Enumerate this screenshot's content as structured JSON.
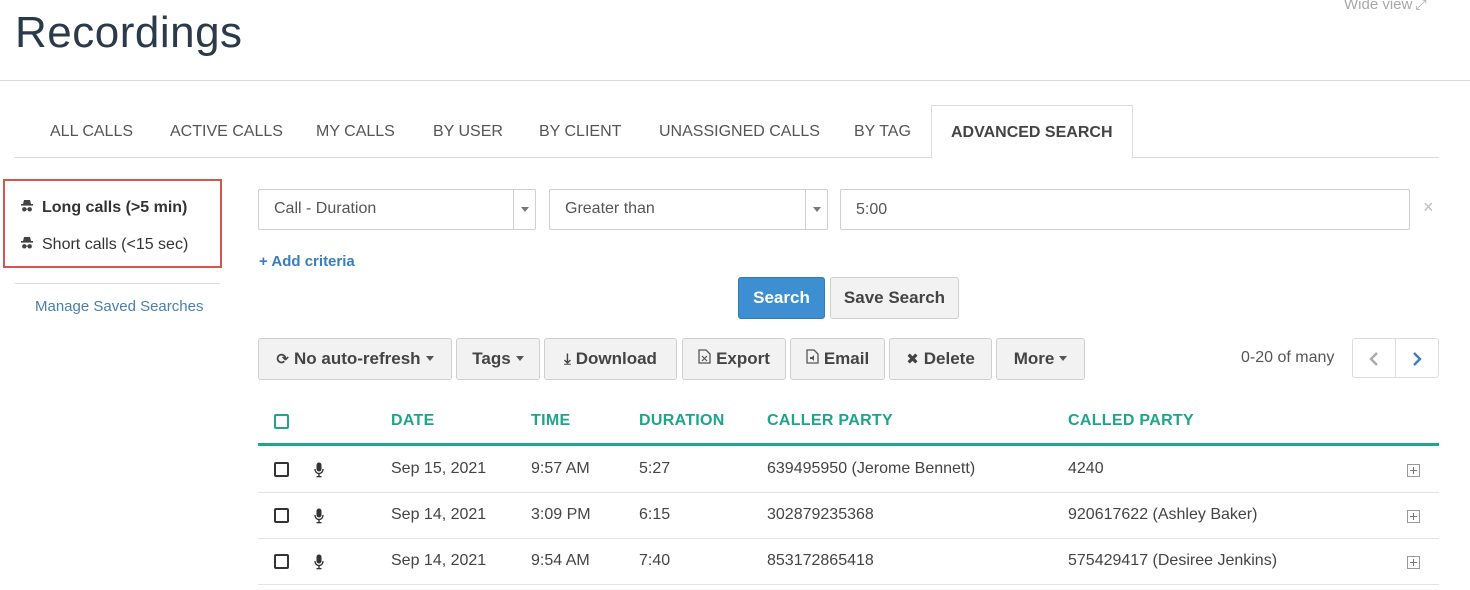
{
  "header": {
    "title": "Recordings",
    "wide_view": "Wide view"
  },
  "tabs": [
    {
      "label": "ALL CALLS"
    },
    {
      "label": "ACTIVE CALLS"
    },
    {
      "label": "MY CALLS"
    },
    {
      "label": "BY USER"
    },
    {
      "label": "BY CLIENT"
    },
    {
      "label": "UNASSIGNED CALLS"
    },
    {
      "label": "BY TAG"
    },
    {
      "label": "ADVANCED SEARCH",
      "active": true
    }
  ],
  "sidebar": {
    "saved_searches": [
      {
        "label": "Long calls (>5 min)",
        "selected": true
      },
      {
        "label": "Short calls (<15 sec)",
        "selected": false
      }
    ],
    "manage_link": "Manage Saved Searches"
  },
  "criteria": {
    "field": "Call - Duration",
    "operator": "Greater than",
    "value": "5:00",
    "add_label": "Add criteria"
  },
  "search_buttons": {
    "search": "Search",
    "save_search": "Save Search"
  },
  "toolbar": {
    "auto_refresh": "No auto-refresh",
    "tags": "Tags",
    "download": "Download",
    "export": "Export",
    "email": "Email",
    "delete": "Delete",
    "more": "More"
  },
  "pagination": {
    "text": "0-20 of many"
  },
  "table": {
    "columns": [
      "DATE",
      "TIME",
      "DURATION",
      "CALLER PARTY",
      "CALLED PARTY"
    ],
    "rows": [
      {
        "date": "Sep 15, 2021",
        "time": "9:57 AM",
        "duration": "5:27",
        "caller": "639495950 (Jerome Bennett)",
        "called": "4240"
      },
      {
        "date": "Sep 14, 2021",
        "time": "3:09 PM",
        "duration": "6:15",
        "caller": "302879235368",
        "called": "920617622 (Ashley Baker)"
      },
      {
        "date": "Sep 14, 2021",
        "time": "9:54 AM",
        "duration": "7:40",
        "caller": "853172865418",
        "called": "575429417 (Desiree Jenkins)"
      }
    ]
  },
  "colors": {
    "accent": "#1ea58b",
    "primary_button": "#3d8fd1",
    "highlight_border": "#d9534f",
    "link": "#4a7fb0"
  }
}
